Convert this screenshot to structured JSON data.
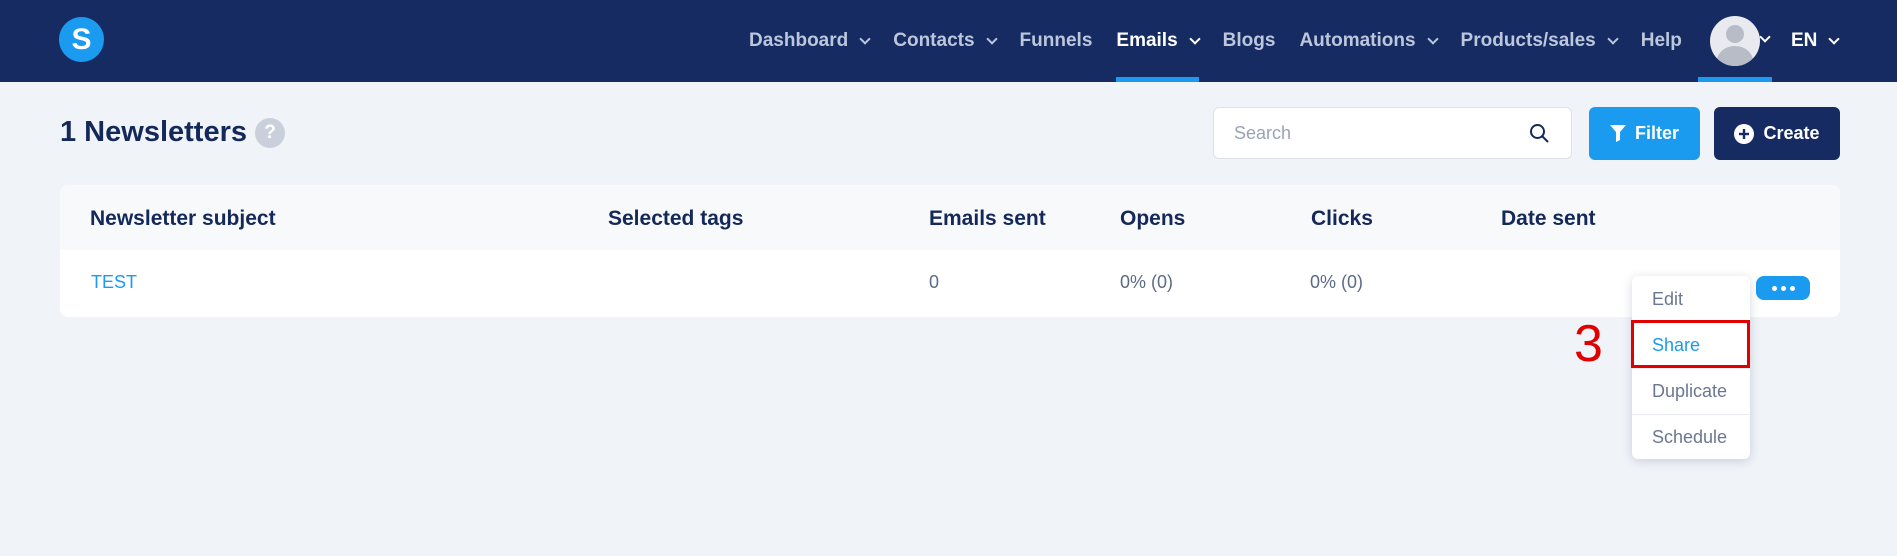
{
  "brand": {
    "logo_letter": "S"
  },
  "nav": {
    "items": [
      {
        "label": "Dashboard",
        "has_dropdown": true
      },
      {
        "label": "Contacts",
        "has_dropdown": true
      },
      {
        "label": "Funnels",
        "has_dropdown": false
      },
      {
        "label": "Emails",
        "has_dropdown": true,
        "active": true
      },
      {
        "label": "Blogs",
        "has_dropdown": false
      },
      {
        "label": "Automations",
        "has_dropdown": true
      },
      {
        "label": "Products/sales",
        "has_dropdown": true
      },
      {
        "label": "Help",
        "has_dropdown": false
      }
    ],
    "language": "EN"
  },
  "page": {
    "title": "1 Newsletters",
    "help_symbol": "?"
  },
  "search": {
    "placeholder": "Search",
    "value": ""
  },
  "buttons": {
    "filter": "Filter",
    "create": "Create"
  },
  "table": {
    "headers": [
      "Newsletter subject",
      "Selected tags",
      "Emails sent",
      "Opens",
      "Clicks",
      "Date sent"
    ],
    "rows": [
      {
        "subject": "TEST",
        "tags": "",
        "emails_sent": "0",
        "opens": "0% (0)",
        "clicks": "0% (0)",
        "date_sent": ""
      }
    ]
  },
  "row_menu": {
    "items": [
      "Edit",
      "Share",
      "Duplicate",
      "Schedule"
    ],
    "highlighted": "Share"
  },
  "annotation": {
    "step": "3"
  },
  "colors": {
    "nav_bg": "#152b62",
    "accent": "#1a9bf0",
    "page_bg": "#f0f3f8",
    "annotation_red": "#e00000"
  }
}
